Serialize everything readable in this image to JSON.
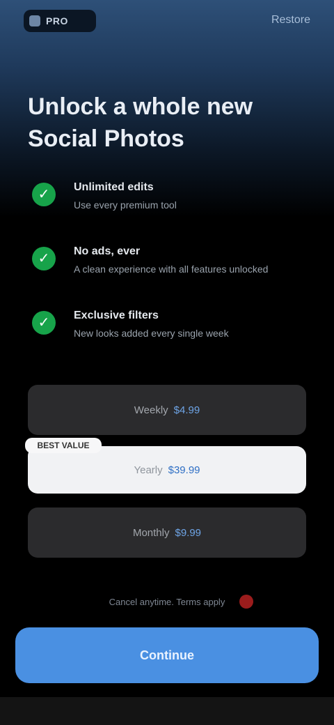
{
  "header": {
    "logo_text": "PRO",
    "top_link": "Restore"
  },
  "headline": "Unlock a whole new Social Photos",
  "features": [
    {
      "title": "Unlimited edits",
      "desc": "Use every premium tool"
    },
    {
      "title": "No ads, ever",
      "desc": "A clean experience with all features unlocked"
    },
    {
      "title": "Exclusive filters",
      "desc": "New looks added every single week"
    }
  ],
  "plans": [
    {
      "name": "Weekly",
      "price": "$4.99"
    },
    {
      "name": "Yearly",
      "price": "$39.99",
      "badge": "BEST VALUE"
    },
    {
      "name": "Monthly",
      "price": "$9.99"
    }
  ],
  "legal_text": "Cancel anytime. Terms apply",
  "cta_label": "Continue",
  "colors": {
    "accent": "#4a90e2",
    "check": "#17a34a"
  }
}
